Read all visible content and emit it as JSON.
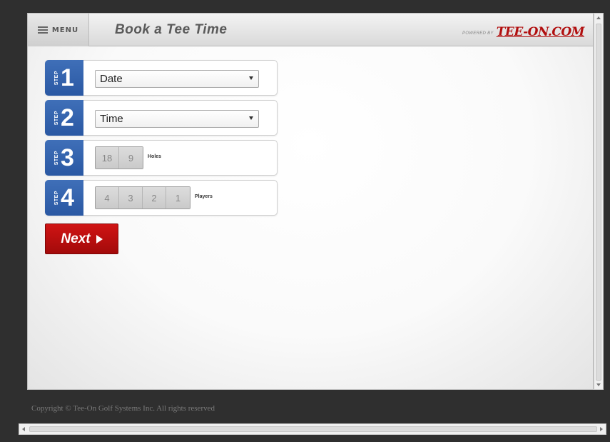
{
  "header": {
    "menu_label": "MENU",
    "title": "Book a Tee Time",
    "powered_by": "POWERED BY",
    "logo_text": "TEE-ON.COM"
  },
  "steps": [
    {
      "word": "STEP",
      "number": "1",
      "select_value": "Date"
    },
    {
      "word": "STEP",
      "number": "2",
      "select_value": "Time"
    },
    {
      "word": "STEP",
      "number": "3",
      "options": [
        "18",
        "9"
      ],
      "label": "Holes"
    },
    {
      "word": "STEP",
      "number": "4",
      "options": [
        "4",
        "3",
        "2",
        "1"
      ],
      "label": "Players"
    }
  ],
  "next_label": "Next",
  "footer": {
    "copyright": "Copyright © Tee-On Golf Systems Inc. All rights reserved"
  },
  "colors": {
    "step_badge": "#2a58a3",
    "next_button": "#b80e0e",
    "logo": "#b10f0f",
    "frame": "#2f2f2f"
  },
  "icons": [
    "hamburger-icon",
    "dropdown-caret-icon",
    "play-arrow-icon"
  ]
}
